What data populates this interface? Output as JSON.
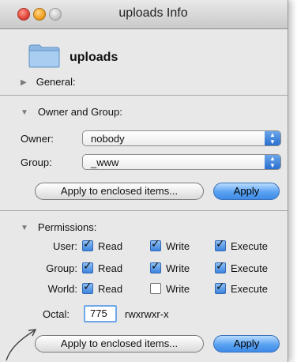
{
  "window": {
    "title": "uploads Info"
  },
  "file": {
    "name": "uploads",
    "icon": "folder-icon"
  },
  "sections": {
    "general": "General:",
    "owner_group": "Owner and Group:",
    "permissions": "Permissions:"
  },
  "owner": {
    "label": "Owner:",
    "value": "nobody"
  },
  "group": {
    "label": "Group:",
    "value": "_www"
  },
  "buttons": {
    "apply_enclosed": "Apply to enclosed items...",
    "apply": "Apply"
  },
  "permissions": {
    "rows": [
      {
        "label": "User:",
        "read": true,
        "write": true,
        "execute": true
      },
      {
        "label": "Group:",
        "read": true,
        "write": true,
        "execute": true
      },
      {
        "label": "World:",
        "read": true,
        "write": false,
        "execute": true
      }
    ],
    "col_labels": {
      "read": "Read",
      "write": "Write",
      "execute": "Execute"
    },
    "octal_label": "Octal:",
    "octal_value": "775",
    "symbolic": "rwxrwxr-x"
  },
  "colors": {
    "accent": "#3e8ae6"
  }
}
